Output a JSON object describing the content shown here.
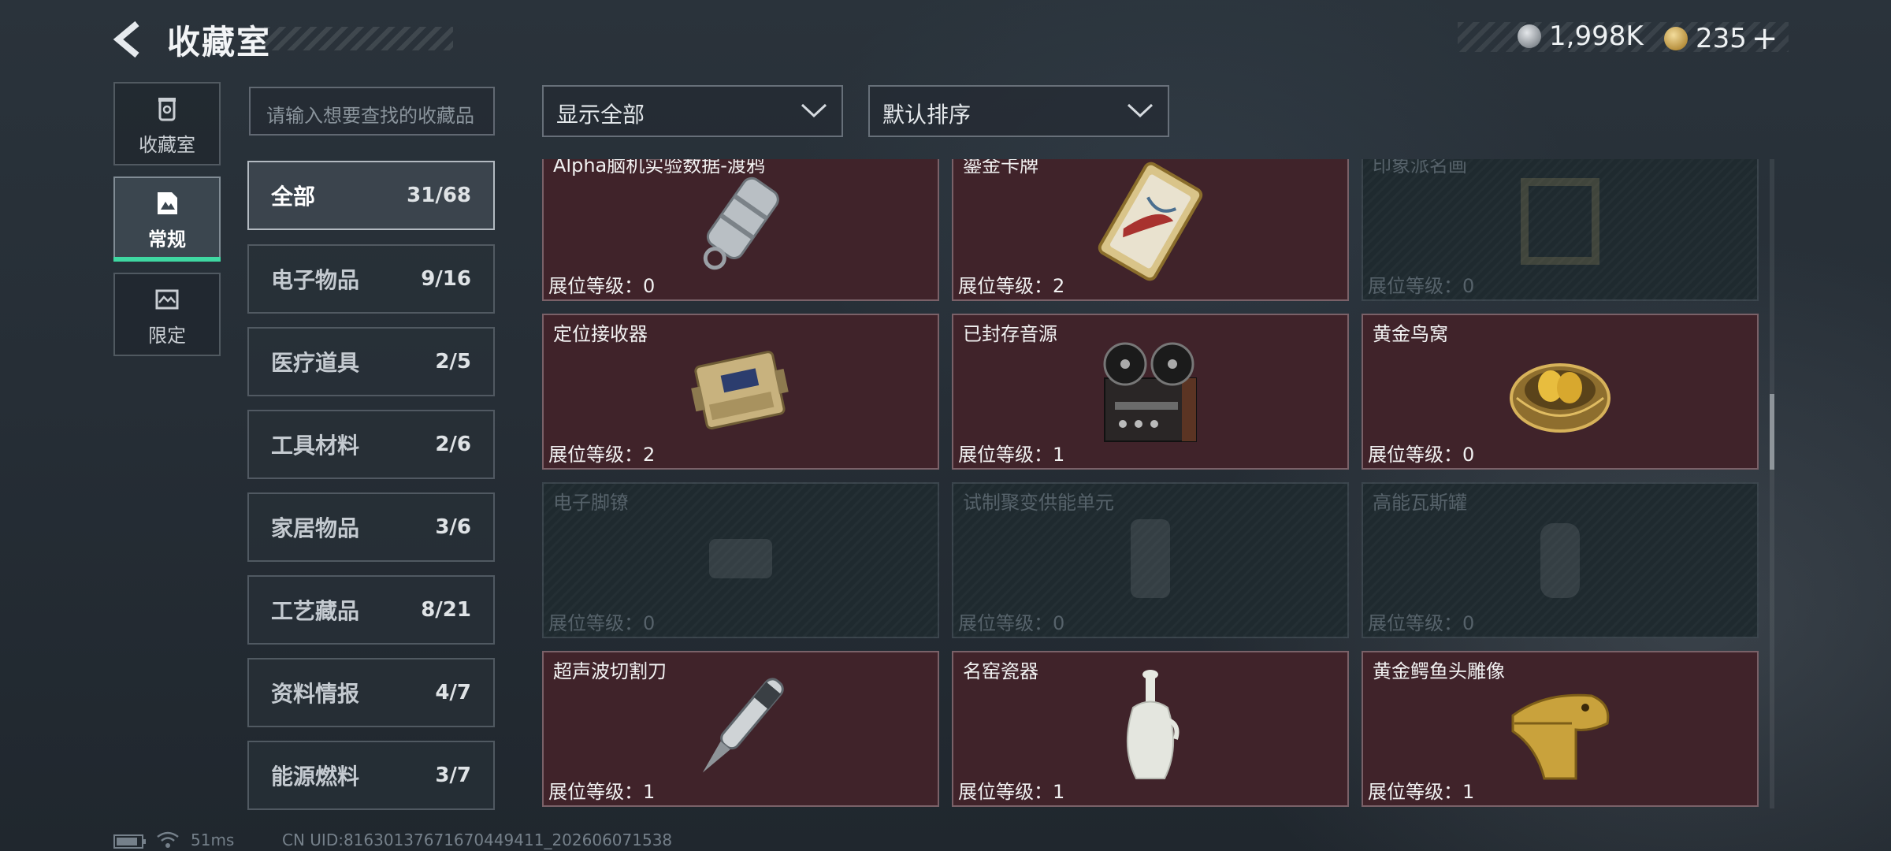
{
  "header": {
    "title": "收藏室",
    "currency_silver": "1,998K",
    "currency_gold": "235",
    "add_symbol": "+"
  },
  "nav": [
    {
      "label": "收藏室",
      "icon": "trash-bin-icon",
      "active": false
    },
    {
      "label": "常规",
      "icon": "document-icon",
      "active": true
    },
    {
      "label": "限定",
      "icon": "map-icon",
      "active": false
    }
  ],
  "search": {
    "placeholder": "请输入想要查找的收藏品"
  },
  "filters": {
    "show_all": "显示全部",
    "sort": "默认排序"
  },
  "categories": [
    {
      "label": "全部",
      "count": "31/68",
      "active": true
    },
    {
      "label": "电子物品",
      "count": "9/16"
    },
    {
      "label": "医疗道具",
      "count": "2/5"
    },
    {
      "label": "工具材料",
      "count": "2/6"
    },
    {
      "label": "家居物品",
      "count": "3/6"
    },
    {
      "label": "工艺藏品",
      "count": "8/21"
    },
    {
      "label": "资料情报",
      "count": "4/7"
    },
    {
      "label": "能源燃料",
      "count": "3/7"
    }
  ],
  "items": [
    {
      "name": "Alpha脑机实验数据-渡鸦",
      "level": "展位等级：0",
      "state": "owned",
      "art": "data-capsule"
    },
    {
      "name": "鎏金卡牌",
      "level": "展位等级：2",
      "state": "owned",
      "art": "card"
    },
    {
      "name": "印象派名画",
      "level": "展位等级：0",
      "state": "locked",
      "art": "frame"
    },
    {
      "name": "定位接收器",
      "level": "展位等级：2",
      "state": "owned",
      "art": "receiver"
    },
    {
      "name": "已封存音源",
      "level": "展位等级：1",
      "state": "owned",
      "art": "reel"
    },
    {
      "name": "黄金鸟窝",
      "level": "展位等级：0",
      "state": "owned",
      "art": "nest"
    },
    {
      "name": "电子脚镣",
      "level": "展位等级：0",
      "state": "locked",
      "art": "shackle"
    },
    {
      "name": "试制聚变供能单元",
      "level": "展位等级：0",
      "state": "locked",
      "art": "fusion"
    },
    {
      "name": "高能瓦斯罐",
      "level": "展位等级：0",
      "state": "locked",
      "art": "gas"
    },
    {
      "name": "超声波切割刀",
      "level": "展位等级：1",
      "state": "owned",
      "art": "knife"
    },
    {
      "name": "名窑瓷器",
      "level": "展位等级：1",
      "state": "owned",
      "art": "vase"
    },
    {
      "name": "黄金鳄鱼头雕像",
      "level": "展位等级：1",
      "state": "owned",
      "art": "croc"
    }
  ],
  "footer": {
    "ping": "51ms",
    "uid": "CN UID:816301376716704494​11_202606071538"
  },
  "colors": {
    "accent": "#3fd8a2",
    "owned_card": "#40232a",
    "locked_card": "#1f2a2f"
  }
}
